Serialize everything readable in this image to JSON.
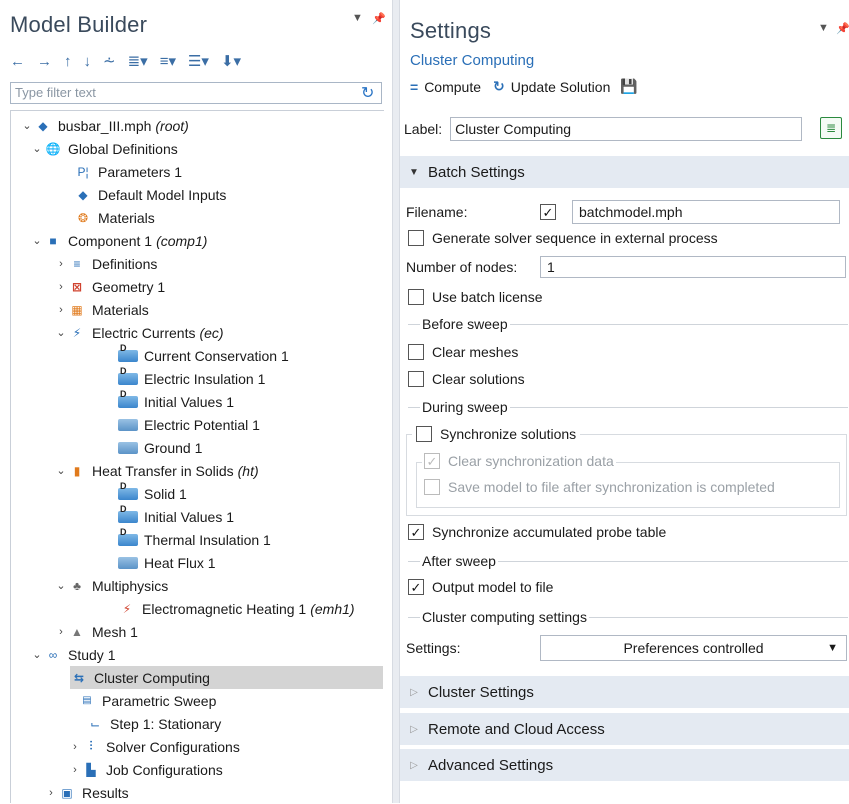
{
  "model_builder": {
    "title": "Model Builder",
    "filter_placeholder": "Type filter text",
    "tree": [
      {
        "label": "busbar_III.mph",
        "tag": "(root)"
      },
      {
        "label": "Global Definitions",
        "tag": ""
      },
      {
        "label": "Parameters 1",
        "tag": ""
      },
      {
        "label": "Default Model Inputs",
        "tag": ""
      },
      {
        "label": "Materials",
        "tag": ""
      },
      {
        "label": "Component 1",
        "tag": "(comp1)"
      },
      {
        "label": "Definitions",
        "tag": ""
      },
      {
        "label": "Geometry 1",
        "tag": ""
      },
      {
        "label": "Materials",
        "tag": ""
      },
      {
        "label": "Electric Currents",
        "tag": "(ec)"
      },
      {
        "label": "Current Conservation 1",
        "tag": ""
      },
      {
        "label": "Electric Insulation 1",
        "tag": ""
      },
      {
        "label": "Initial Values 1",
        "tag": ""
      },
      {
        "label": "Electric Potential 1",
        "tag": ""
      },
      {
        "label": "Ground 1",
        "tag": ""
      },
      {
        "label": "Heat Transfer in Solids",
        "tag": "(ht)"
      },
      {
        "label": "Solid 1",
        "tag": ""
      },
      {
        "label": "Initial Values 1",
        "tag": ""
      },
      {
        "label": "Thermal Insulation 1",
        "tag": ""
      },
      {
        "label": "Heat Flux 1",
        "tag": ""
      },
      {
        "label": "Multiphysics",
        "tag": ""
      },
      {
        "label": "Electromagnetic Heating 1",
        "tag": "(emh1)"
      },
      {
        "label": "Mesh 1",
        "tag": ""
      },
      {
        "label": "Study 1",
        "tag": ""
      },
      {
        "label": "Cluster Computing",
        "tag": ""
      },
      {
        "label": "Parametric Sweep",
        "tag": ""
      },
      {
        "label": "Step 1: Stationary",
        "tag": ""
      },
      {
        "label": "Solver Configurations",
        "tag": ""
      },
      {
        "label": "Job Configurations",
        "tag": ""
      },
      {
        "label": "Results",
        "tag": ""
      }
    ]
  },
  "settings": {
    "title": "Settings",
    "subtitle": "Cluster Computing",
    "compute_label": "Compute",
    "update_label": "Update Solution",
    "label_caption": "Label:",
    "label_value": "Cluster Computing",
    "batch_section": "Batch Settings",
    "filename_caption": "Filename:",
    "filename_value": "batchmodel.mph",
    "generate_solver": "Generate solver sequence in external process",
    "nodes_caption": "Number of nodes:",
    "nodes_value": "1",
    "use_batch_license": "Use batch license",
    "before_sweep": "Before sweep",
    "clear_meshes": "Clear meshes",
    "clear_solutions": "Clear solutions",
    "during_sweep": "During sweep",
    "synchronize_solutions": "Synchronize solutions",
    "clear_sync_data": "Clear synchronization data",
    "save_model_after_sync": "Save model to file after synchronization is completed",
    "sync_probe_table": "Synchronize accumulated probe table",
    "after_sweep": "After sweep",
    "output_model": "Output model to file",
    "cluster_computing_settings": "Cluster computing settings",
    "settings_caption": "Settings:",
    "settings_value": "Preferences controlled",
    "cluster_settings_section": "Cluster Settings",
    "remote_cloud_section": "Remote and Cloud Access",
    "advanced_section": "Advanced Settings"
  }
}
